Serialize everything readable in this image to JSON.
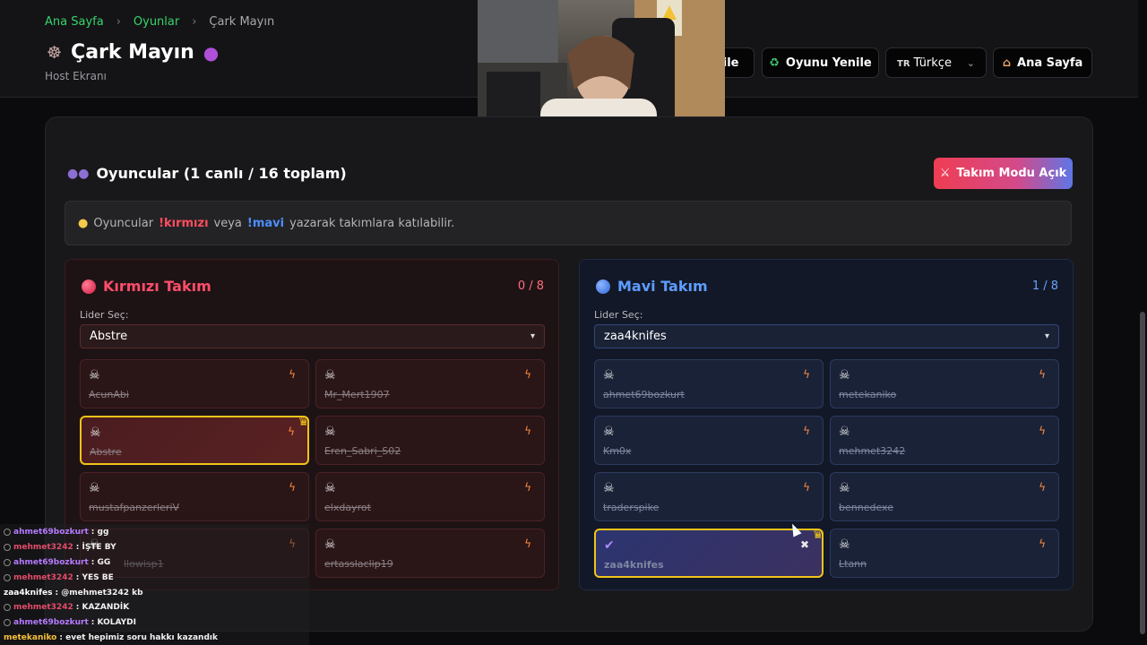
{
  "breadcrumb": {
    "home": "Ana Sayfa",
    "games": "Oyunlar",
    "current": "Çark Mayın"
  },
  "header": {
    "title": "Çark Mayın",
    "subtitle": "Host Ekranı",
    "title_icon": "wheel-icon",
    "bomb_icon": "bomb-icon"
  },
  "toolbar": {
    "partial_label": "nile",
    "reset_label": "Oyunu Yenile",
    "language_label": "Türkçe",
    "language_flag": "TR",
    "home_label": "Ana Sayfa"
  },
  "players": {
    "heading": "Oyuncular (1 canlı / 16 toplam)",
    "team_mode_label": "Takım Modu Açık",
    "info_prefix": "Oyuncular",
    "info_red_cmd": "!kırmızı",
    "info_mid": "veya",
    "info_blue_cmd": "!mavi",
    "info_suffix": "yazarak takımlara katılabilir."
  },
  "red_team": {
    "name": "Kırmızı Takım",
    "count": "0 / 8",
    "leader_label": "Lider Seç:",
    "leader_value": "Abstre",
    "players": [
      "AcunAbi",
      "Mr_Mert1907",
      "Abstre",
      "Eren_Sabri_S02",
      "mustafpanzerleriV",
      "elxdayrot",
      "llowisp1",
      "ertasslaclip19"
    ]
  },
  "blue_team": {
    "name": "Mavi Takım",
    "count": "1 / 8",
    "leader_label": "Lider Seç:",
    "leader_value": "zaa4knifes",
    "players": [
      "ahmet69bozkurt",
      "metekaniko",
      "Km0x",
      "mehmet3242",
      "traderspike",
      "bennedexe",
      "zaa4knifes",
      "Ltann"
    ]
  },
  "chat": [
    {
      "user": "ahmet69bozkurt",
      "message": ": gg",
      "color": "#b67bff"
    },
    {
      "user": "mehmet3242",
      "message": ": İŞTE BY",
      "color": "#e44c6a"
    },
    {
      "user": "ahmet69bozkurt",
      "message": ": GG",
      "color": "#b67bff"
    },
    {
      "user": "mehmet3242",
      "message": ": YES BE",
      "color": "#e44c6a"
    },
    {
      "user": "zaa4knifes",
      "message": ": @mehmet3242 kb",
      "color": "#ffffff"
    },
    {
      "user": "mehmet3242",
      "message": ": KAZANDİK",
      "color": "#e44c6a"
    },
    {
      "user": "ahmet69bozkurt",
      "message": ": KOLAYDI",
      "color": "#b67bff"
    },
    {
      "user": "metekaniko",
      "message": ": evet hepimiz soru hakkı kazandık",
      "color": "#f6c23b"
    }
  ],
  "colors": {
    "accent_green": "#37d46b",
    "red": "#ff4d6a",
    "blue": "#5e9cff",
    "leader_border": "#f0c419"
  }
}
